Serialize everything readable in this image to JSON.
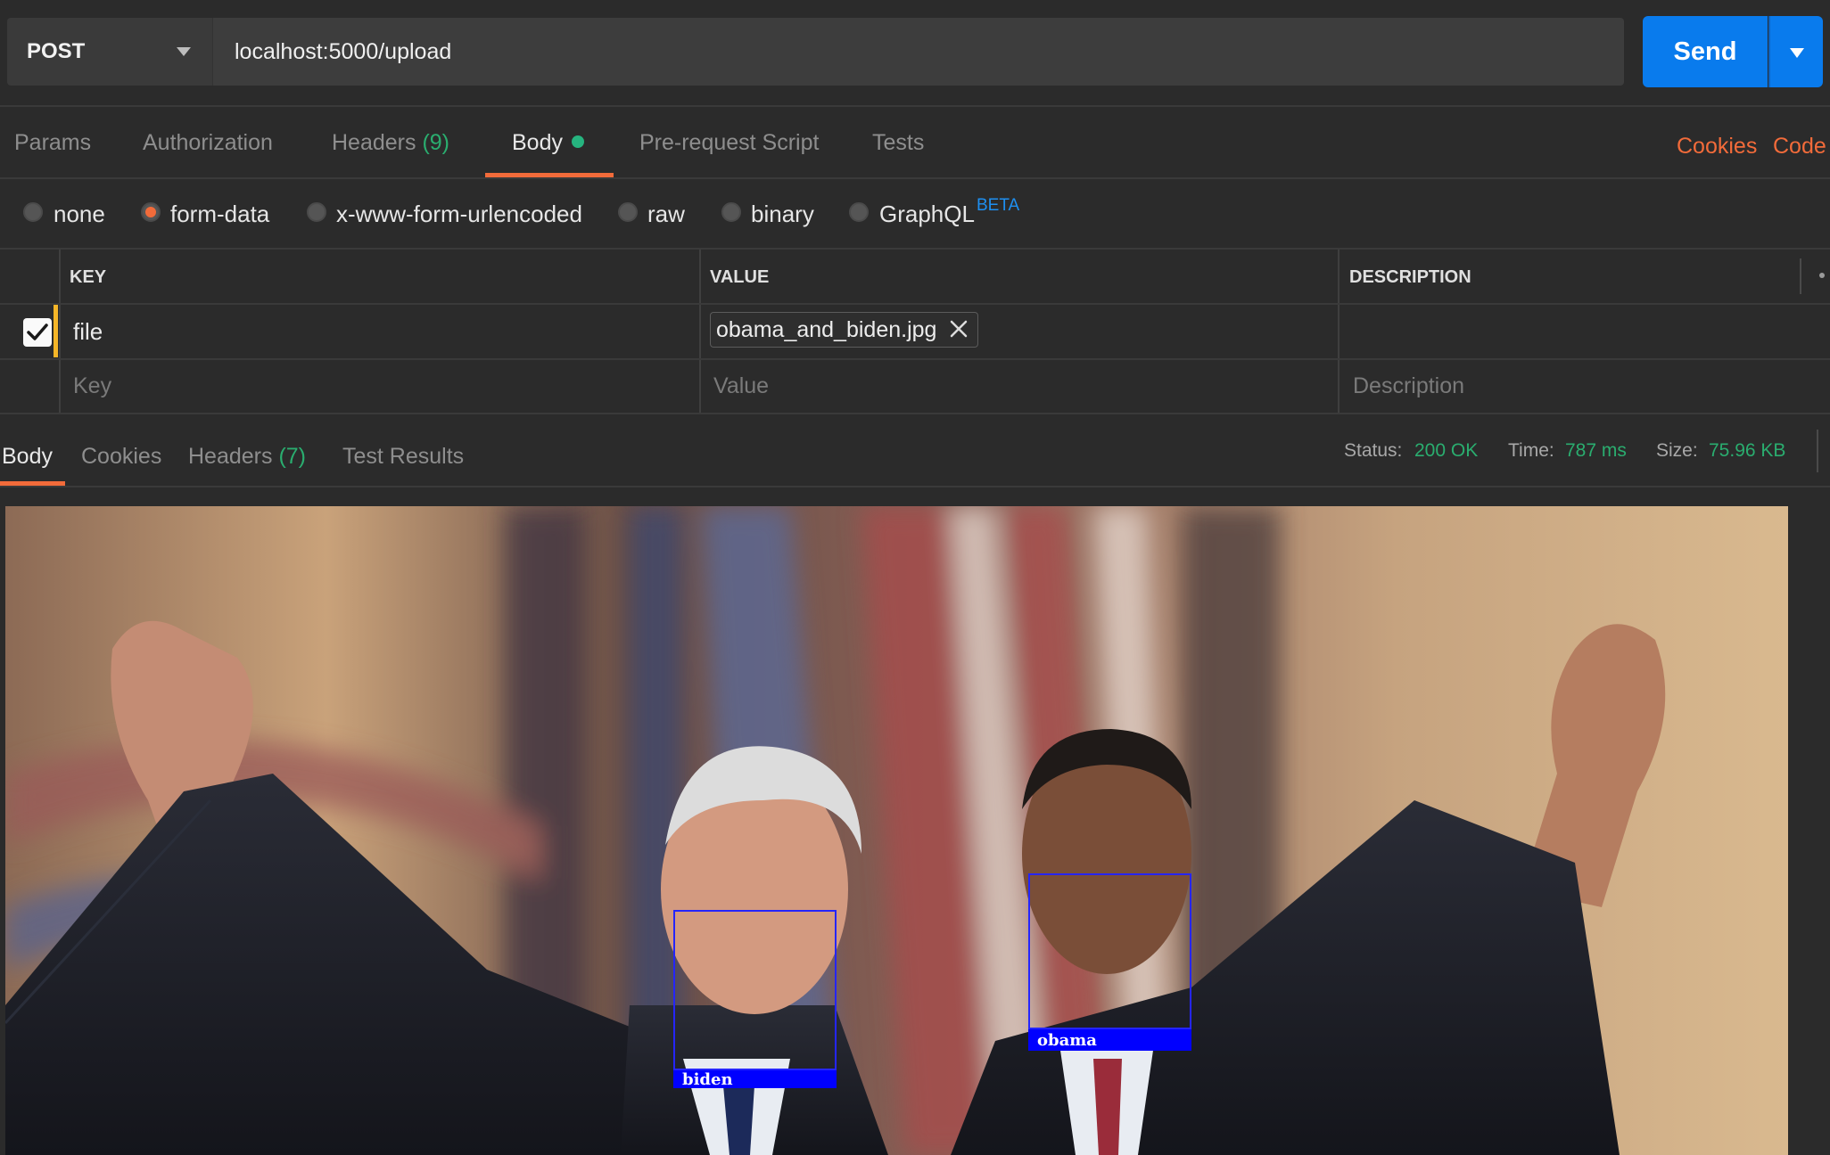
{
  "request": {
    "method": "POST",
    "url": "localhost:5000/upload",
    "send_label": "Send"
  },
  "request_tabs": {
    "params": "Params",
    "authorization": "Authorization",
    "headers": "Headers",
    "headers_count": "(9)",
    "body": "Body",
    "prerequest": "Pre-request Script",
    "tests": "Tests",
    "cookies": "Cookies",
    "code": "Code"
  },
  "body_types": {
    "none": "none",
    "form_data": "form-data",
    "urlencoded": "x-www-form-urlencoded",
    "raw": "raw",
    "binary": "binary",
    "graphql": "GraphQL",
    "beta": "BETA",
    "selected": "form-data"
  },
  "form_table": {
    "headers": {
      "key": "KEY",
      "value": "VALUE",
      "description": "DESCRIPTION"
    },
    "rows": [
      {
        "checked": true,
        "key": "file",
        "value": "obama_and_biden.jpg"
      }
    ],
    "placeholders": {
      "key": "Key",
      "value": "Value",
      "description": "Description"
    }
  },
  "response_tabs": {
    "body": "Body",
    "cookies": "Cookies",
    "headers": "Headers",
    "headers_count": "(7)",
    "test_results": "Test Results"
  },
  "response_status": {
    "status_label": "Status:",
    "status_value": "200 OK",
    "time_label": "Time:",
    "time_value": "787 ms",
    "size_label": "Size:",
    "size_value": "75.96 KB"
  },
  "response_image": {
    "labels": [
      "biden",
      "obama"
    ]
  },
  "colors": {
    "accent_orange": "#f26b3a",
    "send_blue": "#097bed",
    "success_green": "#2aad6f",
    "beta_blue": "#1e8ff0",
    "box_blue": "#0000ff"
  }
}
